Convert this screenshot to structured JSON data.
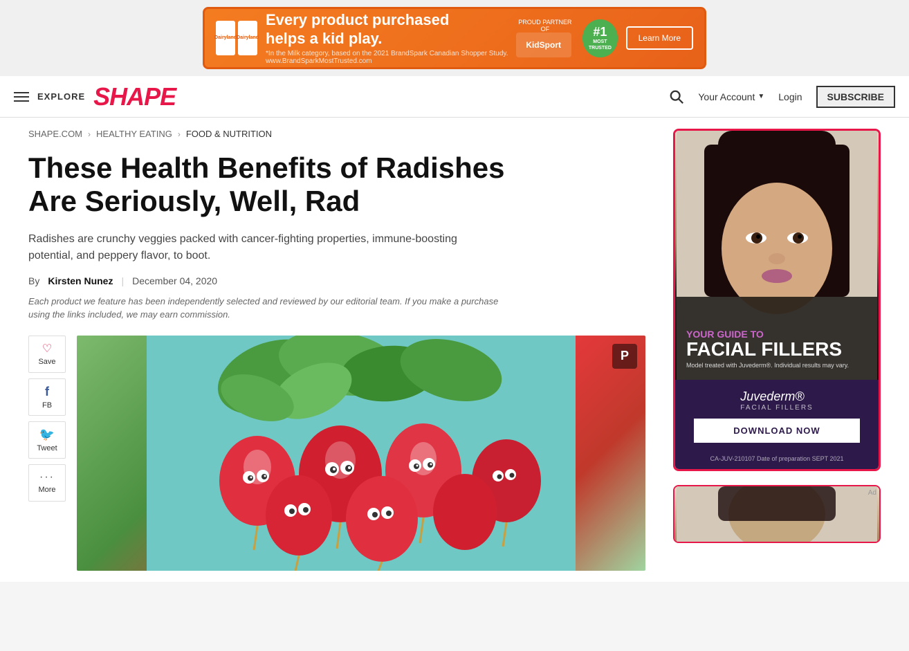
{
  "top_ad": {
    "main_text": "Every product purchased\nhelps a kid play.",
    "sub_text": "*In the Milk category, based on the 2021 BrandSpark Canadian Shopper Study. www.BrandSparkMostTrusted.com",
    "partner_label": "PROUD PARTNER OF",
    "partner_name": "KidSport",
    "badge_num": "#1",
    "badge_line1": "MOST",
    "badge_line2": "TRUSTED",
    "learn_more": "Learn More",
    "brand1": "Dairyland",
    "brand2": "Dairyland"
  },
  "navbar": {
    "explore_label": "EXPLORE",
    "logo": "SHAPE",
    "your_account": "Your Account",
    "login": "Login",
    "subscribe": "SUBSCRIBE"
  },
  "breadcrumb": {
    "items": [
      {
        "label": "SHAPE.COM",
        "href": "#"
      },
      {
        "label": "HEALTHY EATING",
        "href": "#"
      },
      {
        "label": "FOOD & NUTRITION",
        "href": "#"
      }
    ]
  },
  "article": {
    "title": "These Health Benefits of Radishes Are Seriously, Well, Rad",
    "subtitle": "Radishes are crunchy veggies packed with cancer-fighting properties, immune-boosting potential, and peppery flavor, to boot.",
    "by_label": "By",
    "author": "Kirsten Nunez",
    "date": "December 04, 2020",
    "disclaimer": "Each product we feature has been independently selected and reviewed by our editorial team. If you make a purchase using the links included, we may earn commission."
  },
  "share_buttons": [
    {
      "icon": "♡",
      "label": "Save",
      "type": "save"
    },
    {
      "icon": "f",
      "label": "FB",
      "type": "fb"
    },
    {
      "icon": "🐦",
      "label": "Tweet",
      "type": "tweet"
    },
    {
      "icon": "···",
      "label": "More",
      "type": "more"
    }
  ],
  "pinterest_icon": "P",
  "sidebar_ad1": {
    "guide_text": "YOUR GUIDE TO",
    "main_text": "FACIAL FILLERS",
    "disclaimer": "Model treated with Juvederm®. Individual results may vary.",
    "brand_name": "Juvederm®",
    "brand_sub": "FACIAL FILLERS",
    "cta": "DOWNLOAD NOW",
    "fine_print": "CA-JUV-210107 Date of preparation SEPT 2021"
  }
}
